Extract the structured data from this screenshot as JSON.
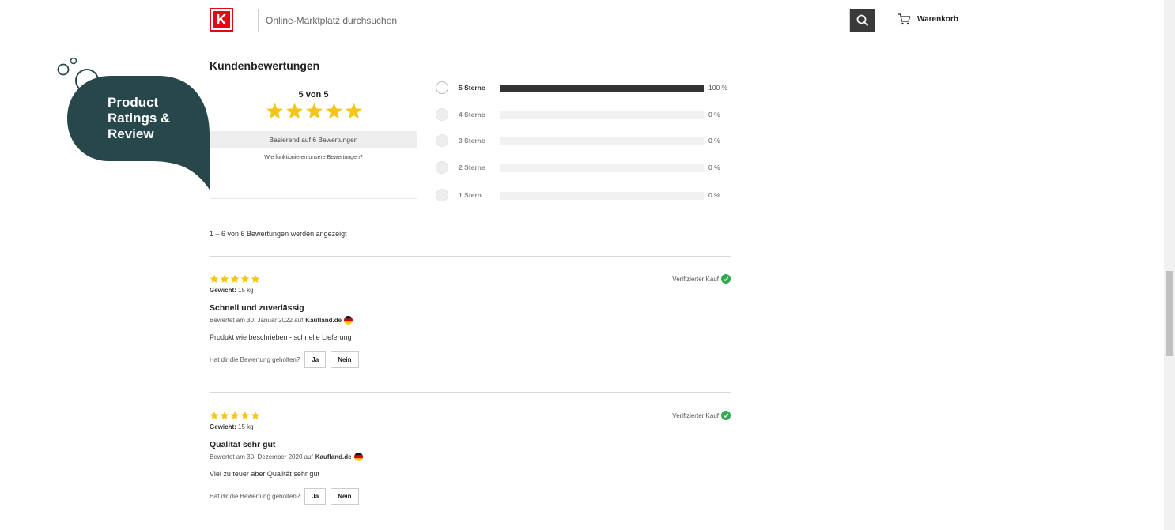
{
  "header": {
    "logo_letter": "K",
    "search_placeholder": "Online-Marktplatz durchsuchen",
    "cart_label": "Warenkorb"
  },
  "promo": {
    "label": "Product Ratings & Review",
    "color": "#27474a"
  },
  "ratings": {
    "title": "Kundenbewertungen",
    "score_text": "5 von 5",
    "score": 5,
    "based_on": "Basierend auf 6 Bewertungen",
    "how_link": "Wie funktionieren unsere Bewertungen?",
    "star_color": "#f5c518",
    "distribution": [
      {
        "label": "5 Sterne",
        "percent": 100,
        "percent_text": "100 %"
      },
      {
        "label": "4 Sterne",
        "percent": 0,
        "percent_text": "0 %"
      },
      {
        "label": "3 Sterne",
        "percent": 0,
        "percent_text": "0 %"
      },
      {
        "label": "2 Sterne",
        "percent": 0,
        "percent_text": "0 %"
      },
      {
        "label": "1 Stern",
        "percent": 0,
        "percent_text": "0 %"
      }
    ]
  },
  "reviews_header": {
    "count_text": "1 – 6 von 6 Bewertungen werden angezeigt"
  },
  "reviews": [
    {
      "stars": 5,
      "verified": "Verifizierter Kauf",
      "weight_label": "Gewicht:",
      "weight_value": "15 kg",
      "title": "Schnell und zuverlässig",
      "meta": "Bewertet am 30. Januar 2022 auf",
      "store": "Kaufland.de",
      "text": "Produkt wie beschrieben - schnelle Lieferung",
      "helpful_question": "Hat dir die Bewertung geholfen?",
      "yes": "Ja",
      "no": "Nein"
    },
    {
      "stars": 5,
      "verified": "Verifizierter Kauf",
      "weight_label": "Gewicht:",
      "weight_value": "15 kg",
      "title": "Qualität sehr gut",
      "meta": "Bewertet am 30. Dezember 2020 auf",
      "store": "Kaufland.de",
      "text": "Viel zu teuer aber Qualität sehr gut",
      "helpful_question": "Hat dir die Bewertung geholfen?",
      "yes": "Ja",
      "no": "Nein"
    }
  ]
}
